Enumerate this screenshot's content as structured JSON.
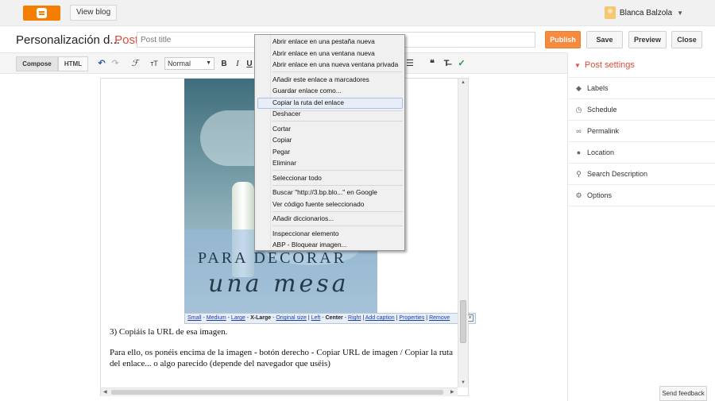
{
  "topbar": {
    "view_blog": "View blog",
    "user_name": "Blanca Balzola"
  },
  "title_row": {
    "blog_name": "Personalización d...",
    "post_label": "· Post",
    "title_placeholder": "Post title",
    "publish": "Publish",
    "save": "Save",
    "preview": "Preview",
    "close": "Close"
  },
  "toolbar": {
    "compose": "Compose",
    "html": "HTML",
    "undo": "↶",
    "redo": "↷",
    "font_glyph": "ℱ",
    "size_glyph": "ᴛT",
    "font_value": "Normal",
    "bold": "B",
    "italic": "I",
    "underline": "U",
    "list": "☰",
    "quote": "❝",
    "clear_format": "T̶",
    "spellcheck": "✓"
  },
  "image": {
    "text_line1": "PARA DECORAR",
    "text_line2": "una mesa"
  },
  "image_bar": {
    "small": "Small",
    "medium": "Medium",
    "large": "Large",
    "xlarge": "X-Large",
    "original": "Original size",
    "left": "Left",
    "center": "Center",
    "right": "Right",
    "add_caption": "Add caption",
    "properties": "Properties",
    "remove": "Remove",
    "close_glyph": "×",
    "dash": "-",
    "pipe": "|"
  },
  "editor": {
    "line1": "3) Copiáis la URL de esa imagen.",
    "para2": "Para ello, os ponéis encima de la imagen - botón derecho - Copiar URL de imagen / Copiar la ruta del enlace... o algo parecido (depende del navegador que uséis)"
  },
  "sidebar": {
    "header": "Post settings",
    "items": [
      {
        "label": "Labels",
        "icon": "tag-icon"
      },
      {
        "label": "Schedule",
        "icon": "clock-icon"
      },
      {
        "label": "Permalink",
        "icon": "link-icon"
      },
      {
        "label": "Location",
        "icon": "location-pin-icon"
      },
      {
        "label": "Search Description",
        "icon": "search-icon"
      },
      {
        "label": "Options",
        "icon": "gear-icon"
      }
    ]
  },
  "context_menu": {
    "items": [
      "Abrir enlace en una pestaña nueva",
      "Abrir enlace en una ventana nueva",
      "Abrir enlace en una nueva ventana privada",
      "Añadir este enlace a marcadores",
      "Guardar enlace como...",
      "Copiar la ruta del enlace",
      "Deshacer",
      "Cortar",
      "Copiar",
      "Pegar",
      "Eliminar",
      "Seleccionar todo",
      "Buscar \"http://3.bp.blo...\" en Google",
      "Ver código fuente seleccionado",
      "Añadir diccionarios...",
      "Inspeccionar elemento",
      "ABP - Bloquear imagen..."
    ]
  },
  "feedback": "Send feedback"
}
